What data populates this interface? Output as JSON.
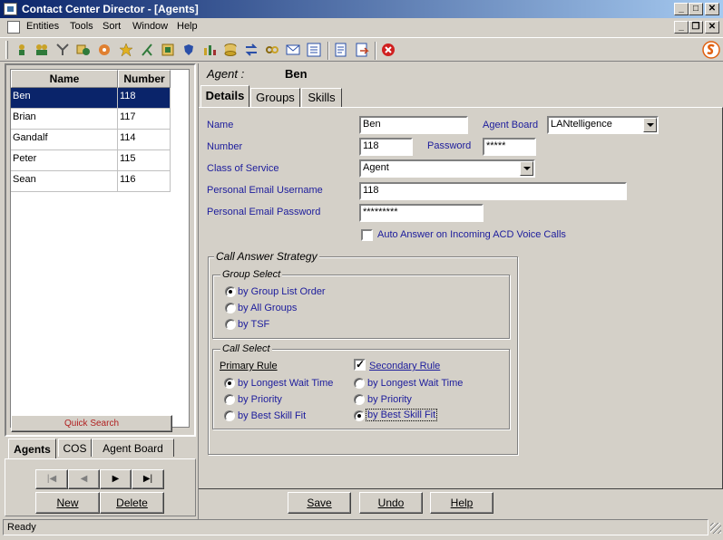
{
  "window": {
    "title": "Contact Center Director - [Agents]",
    "min": "_",
    "max": "□",
    "close": "✕",
    "child_min": "_",
    "child_restore": "❐",
    "child_close": "✕"
  },
  "menu": [
    "Entities",
    "Tools",
    "Sort",
    "Window",
    "Help"
  ],
  "menu_underline": [
    "E",
    "T",
    "S",
    "W",
    "H"
  ],
  "toolbar_icons": [
    "agent-icon",
    "agents-icon",
    "split-icon",
    "group-icon",
    "skill-icon",
    "star-icon",
    "route-icon",
    "book-icon",
    "shield-icon",
    "bars-icon",
    "database-icon",
    "transfer-icon",
    "link-icon",
    "mail-icon",
    "list-icon",
    "report-icon",
    "export-icon",
    "stop-icon"
  ],
  "grid": {
    "headers": [
      "Name",
      "Number"
    ],
    "rows": [
      {
        "name": "Ben",
        "number": "118"
      },
      {
        "name": "Brian",
        "number": "117"
      },
      {
        "name": "Gandalf",
        "number": "114"
      },
      {
        "name": "Peter",
        "number": "115"
      },
      {
        "name": "Sean",
        "number": "116"
      }
    ],
    "quick_search": "Quick Search"
  },
  "left_tabs": [
    "Agents",
    "COS",
    "Agent Board"
  ],
  "nav": {
    "first": "|◀",
    "prev": "◀",
    "next": "▶",
    "last": "▶|",
    "new": "New",
    "delete": "Delete"
  },
  "header": {
    "label": "Agent :",
    "value": "Ben"
  },
  "tabs": [
    "Details",
    "Groups",
    "Skills"
  ],
  "form": {
    "name_label": "Name",
    "name_value": "Ben",
    "agent_board_label": "Agent Board",
    "agent_board_value": "LANtelligence",
    "number_label": "Number",
    "number_value": "118",
    "password_label": "Password",
    "password_value": "*****",
    "cos_label": "Class of Service",
    "cos_value": "Agent",
    "email_user_label": "Personal Email Username",
    "email_user_value": "118",
    "email_pass_label": "Personal Email Password",
    "email_pass_value": "*********",
    "auto_answer_label": "Auto Answer on Incoming ACD Voice Calls"
  },
  "strategy": {
    "title": "Call Answer Strategy",
    "group_select": "Group Select",
    "group_options": [
      "by Group List Order",
      "by All Groups",
      "by TSF"
    ],
    "call_select": "Call Select",
    "primary_rule": "Primary Rule",
    "secondary_rule": "Secondary Rule",
    "primary_options": [
      "by Longest Wait Time",
      "by Priority",
      "by Best Skill Fit"
    ],
    "secondary_options": [
      "by Longest Wait Time",
      "by Priority",
      "by Best Skill Fit"
    ]
  },
  "buttons": {
    "save": "Save",
    "undo": "Undo",
    "help": "Help"
  },
  "status": "Ready"
}
